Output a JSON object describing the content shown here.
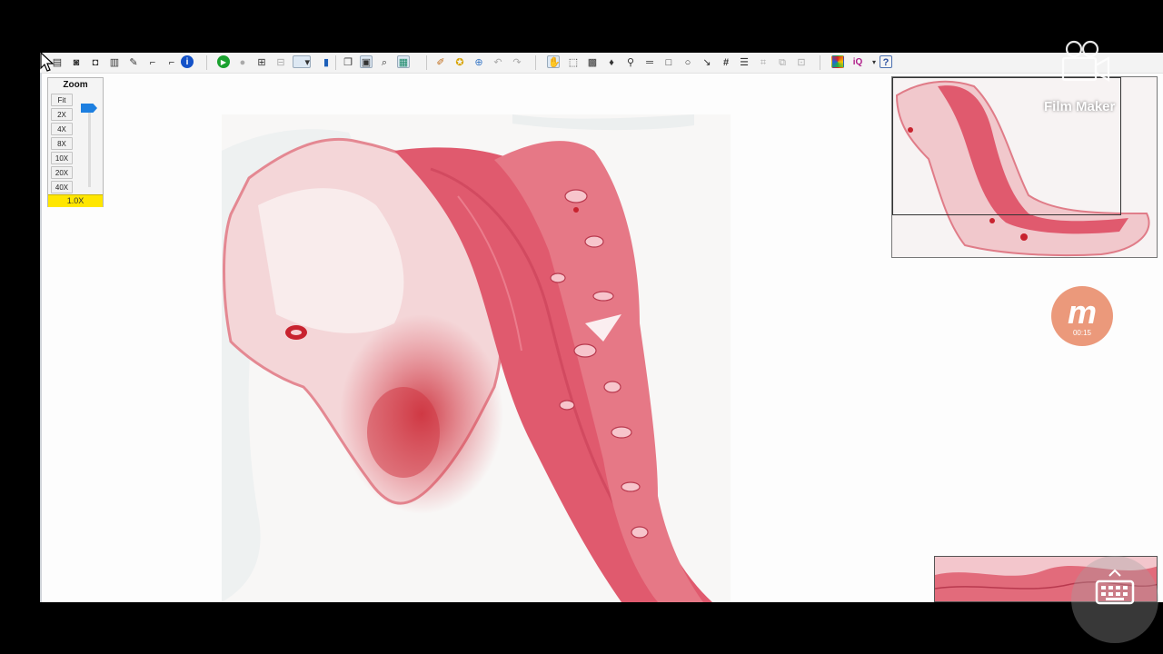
{
  "toolbar": {
    "tools": [
      {
        "name": "open-folder-icon",
        "glyph": "▤"
      },
      {
        "name": "camera-icon",
        "glyph": "◙"
      },
      {
        "name": "snapshot-icon",
        "glyph": "◘"
      },
      {
        "name": "print-icon",
        "glyph": "▥"
      },
      {
        "name": "annotate-icon",
        "glyph": "✎"
      },
      {
        "name": "tree-icon",
        "glyph": "⌐"
      },
      {
        "name": "info-icon",
        "glyph": "i"
      },
      {
        "name": "play-icon",
        "glyph": "▶"
      },
      {
        "name": "stop-icon",
        "glyph": "●"
      },
      {
        "name": "layout-icon",
        "glyph": "⊞"
      },
      {
        "name": "split-icon",
        "glyph": "⊟"
      },
      {
        "name": "select-dropdown-icon",
        "glyph": "▾"
      },
      {
        "name": "bookmark-icon",
        "glyph": "▮"
      },
      {
        "name": "copy-icon",
        "glyph": "❐"
      },
      {
        "name": "window-icon",
        "glyph": "▣"
      },
      {
        "name": "search-icon",
        "glyph": "⌕"
      },
      {
        "name": "screen-icon",
        "glyph": "▦"
      },
      {
        "name": "edit-icon",
        "glyph": "✐"
      },
      {
        "name": "stamp-icon",
        "glyph": "✪"
      },
      {
        "name": "grid-icon",
        "glyph": "⊕"
      },
      {
        "name": "undo-icon",
        "glyph": "↶"
      },
      {
        "name": "redo-icon",
        "glyph": "↷"
      },
      {
        "name": "hand-icon",
        "glyph": "✋"
      },
      {
        "name": "select-region-icon",
        "glyph": "⬚"
      },
      {
        "name": "capture-icon",
        "glyph": "▩"
      },
      {
        "name": "pin-icon",
        "glyph": "♦"
      },
      {
        "name": "measure-pen-icon",
        "glyph": "⚲"
      },
      {
        "name": "ruler-icon",
        "glyph": "═"
      },
      {
        "name": "rectangle-icon",
        "glyph": "□"
      },
      {
        "name": "ellipse-icon",
        "glyph": "○"
      },
      {
        "name": "arrow-icon",
        "glyph": "↘"
      },
      {
        "name": "hash-grid-icon",
        "glyph": "#"
      },
      {
        "name": "list-icon",
        "glyph": "☰"
      },
      {
        "name": "crop-icon",
        "glyph": "⌗"
      },
      {
        "name": "duplicate-icon",
        "glyph": "⧉"
      },
      {
        "name": "tile-icon",
        "glyph": "⊡"
      },
      {
        "name": "color-icon",
        "glyph": "■"
      },
      {
        "name": "iq-icon",
        "glyph": "iQ"
      },
      {
        "name": "help-icon",
        "glyph": "?"
      }
    ]
  },
  "zoom_panel": {
    "title": "Zoom",
    "buttons": [
      "Fit",
      "2X",
      "4X",
      "8X",
      "10X",
      "20X",
      "40X"
    ],
    "current_level": "1.0X",
    "indicator_color": "#ffe600"
  },
  "overlays": {
    "film_maker_label": "Film Maker",
    "recorder_badge_letter": "m",
    "recorder_time": "00:15"
  },
  "colors": {
    "tissue_dark": "#e05a6e",
    "tissue_light": "#f3b9c0",
    "hemorrhage": "#c8232f",
    "thumb_slider": "#1d7fe0"
  }
}
